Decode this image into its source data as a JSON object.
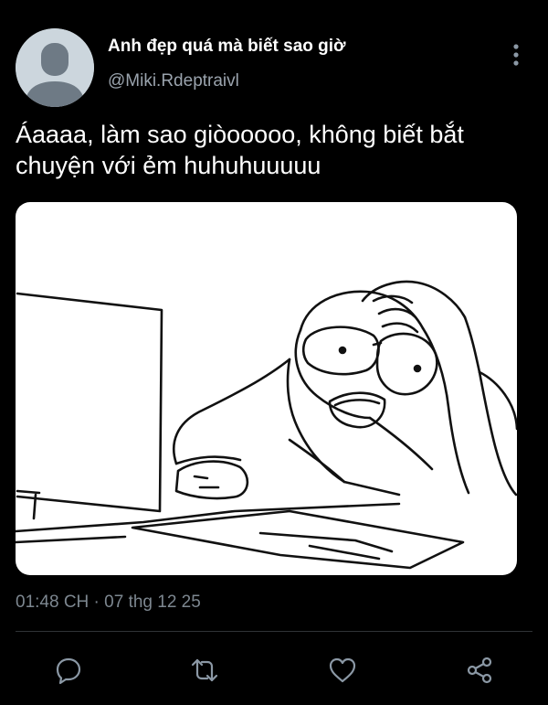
{
  "author": {
    "display_name": "Anh đẹp quá mà biết sao giờ",
    "handle": "@Miki.Rdeptraivl",
    "avatar_icon": "default-avatar-icon"
  },
  "tweet": {
    "text": "Áaaaa, làm sao giòooooo, không biết bắt chuyện với ẻm huhuhuuuuu",
    "media_description_icon": "stressed-man-at-computer-drawing",
    "timestamp": "01:48 CH · 07 thg 12 25"
  },
  "actions": {
    "reply_icon": "comment-icon",
    "retweet_icon": "retweet-icon",
    "like_icon": "heart-icon",
    "share_icon": "share-icon",
    "more_icon": "more-vertical-icon"
  },
  "colors": {
    "background": "#000000",
    "primary_text": "#ffffff",
    "secondary_text": "#9aa3ad",
    "icon": "#8b98a5",
    "divider": "#2f3336",
    "avatar_bg": "#ccd6dd",
    "avatar_fg": "#6e7a85"
  }
}
